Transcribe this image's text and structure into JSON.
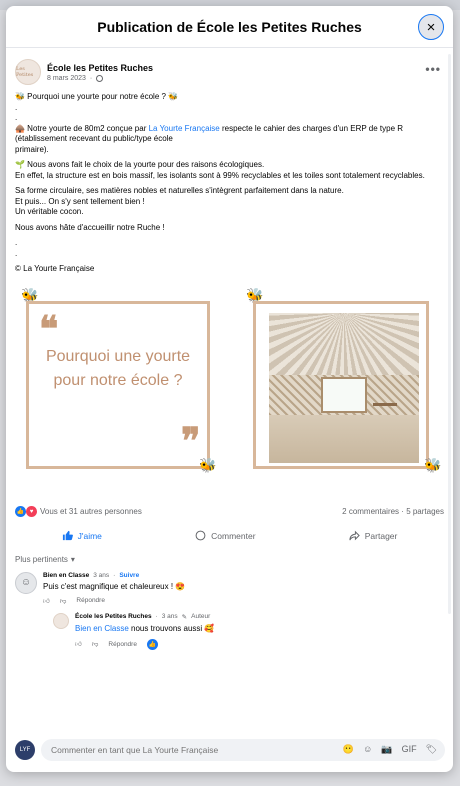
{
  "modal": {
    "title": "Publication de École les Petites Ruches",
    "close_icon": "×"
  },
  "post": {
    "author": "École les Petites Ruches",
    "date": "8 mars 2023",
    "more_icon": "•••",
    "avatar_text": "Les Petites",
    "lines": {
      "title": "🐝 Pourquoi une yourte pour notre école ? 🐝",
      "dot1": ".",
      "dot2": ".",
      "p1_a": "🛖 Notre yourte de 80m2 conçue par ",
      "p1_link": "La Yourte Française",
      "p1_b": " respecte le cahier des charges d'un ERP de type R (établissement recevant du public/type école",
      "p1_c": "primaire).",
      "p2": "🌱 Nous avons fait le choix de la yourte pour des raisons écologiques.",
      "p3": "En effet, la structure est en bois massif, les isolants sont à 99% recyclables et les toiles sont totalement recyclables.",
      "p4": "Sa forme circulaire, ses matières nobles et naturelles s'intègrent parfaitement dans la nature.",
      "p5": "Et puis... On s'y sent tellement bien !",
      "p6": "Un véritable cocon.",
      "p7": "Nous avons hâte d'accueillir notre Ruche !",
      "dot3": ".",
      "dot4": ".",
      "credit": "© La Yourte Française"
    },
    "card_text": "Pourquoi une yourte pour notre école ?",
    "quote_open": "❝",
    "quote_close": "❞"
  },
  "reactions": {
    "summary": "Vous et 31 autres personnes",
    "comments": "2 commentaires",
    "shares": "5 partages",
    "like_icon": "👍",
    "love_icon": "♥"
  },
  "actions": {
    "like": "J'aime",
    "comment": "Commenter",
    "share": "Partager"
  },
  "comments": {
    "sort_label": "Plus pertinents",
    "items": [
      {
        "name": "Bien en Classe",
        "time": "3 ans",
        "follow": "Suivre",
        "text": "Puis c'est magnifique et chaleureux ! 😍",
        "reply_label": "Répondre"
      }
    ],
    "reply": {
      "name": "École les Petites Ruches",
      "time": "3 ans",
      "badge": "Auteur",
      "mention": "Bien en Classe",
      "text": " nous trouvons aussi 🥰",
      "reply_label": "Répondre"
    }
  },
  "composer": {
    "placeholder": "Commenter en tant que La Yourte Française",
    "icons": [
      "😶",
      "☺",
      "📷",
      "GIF",
      "🏷"
    ]
  }
}
